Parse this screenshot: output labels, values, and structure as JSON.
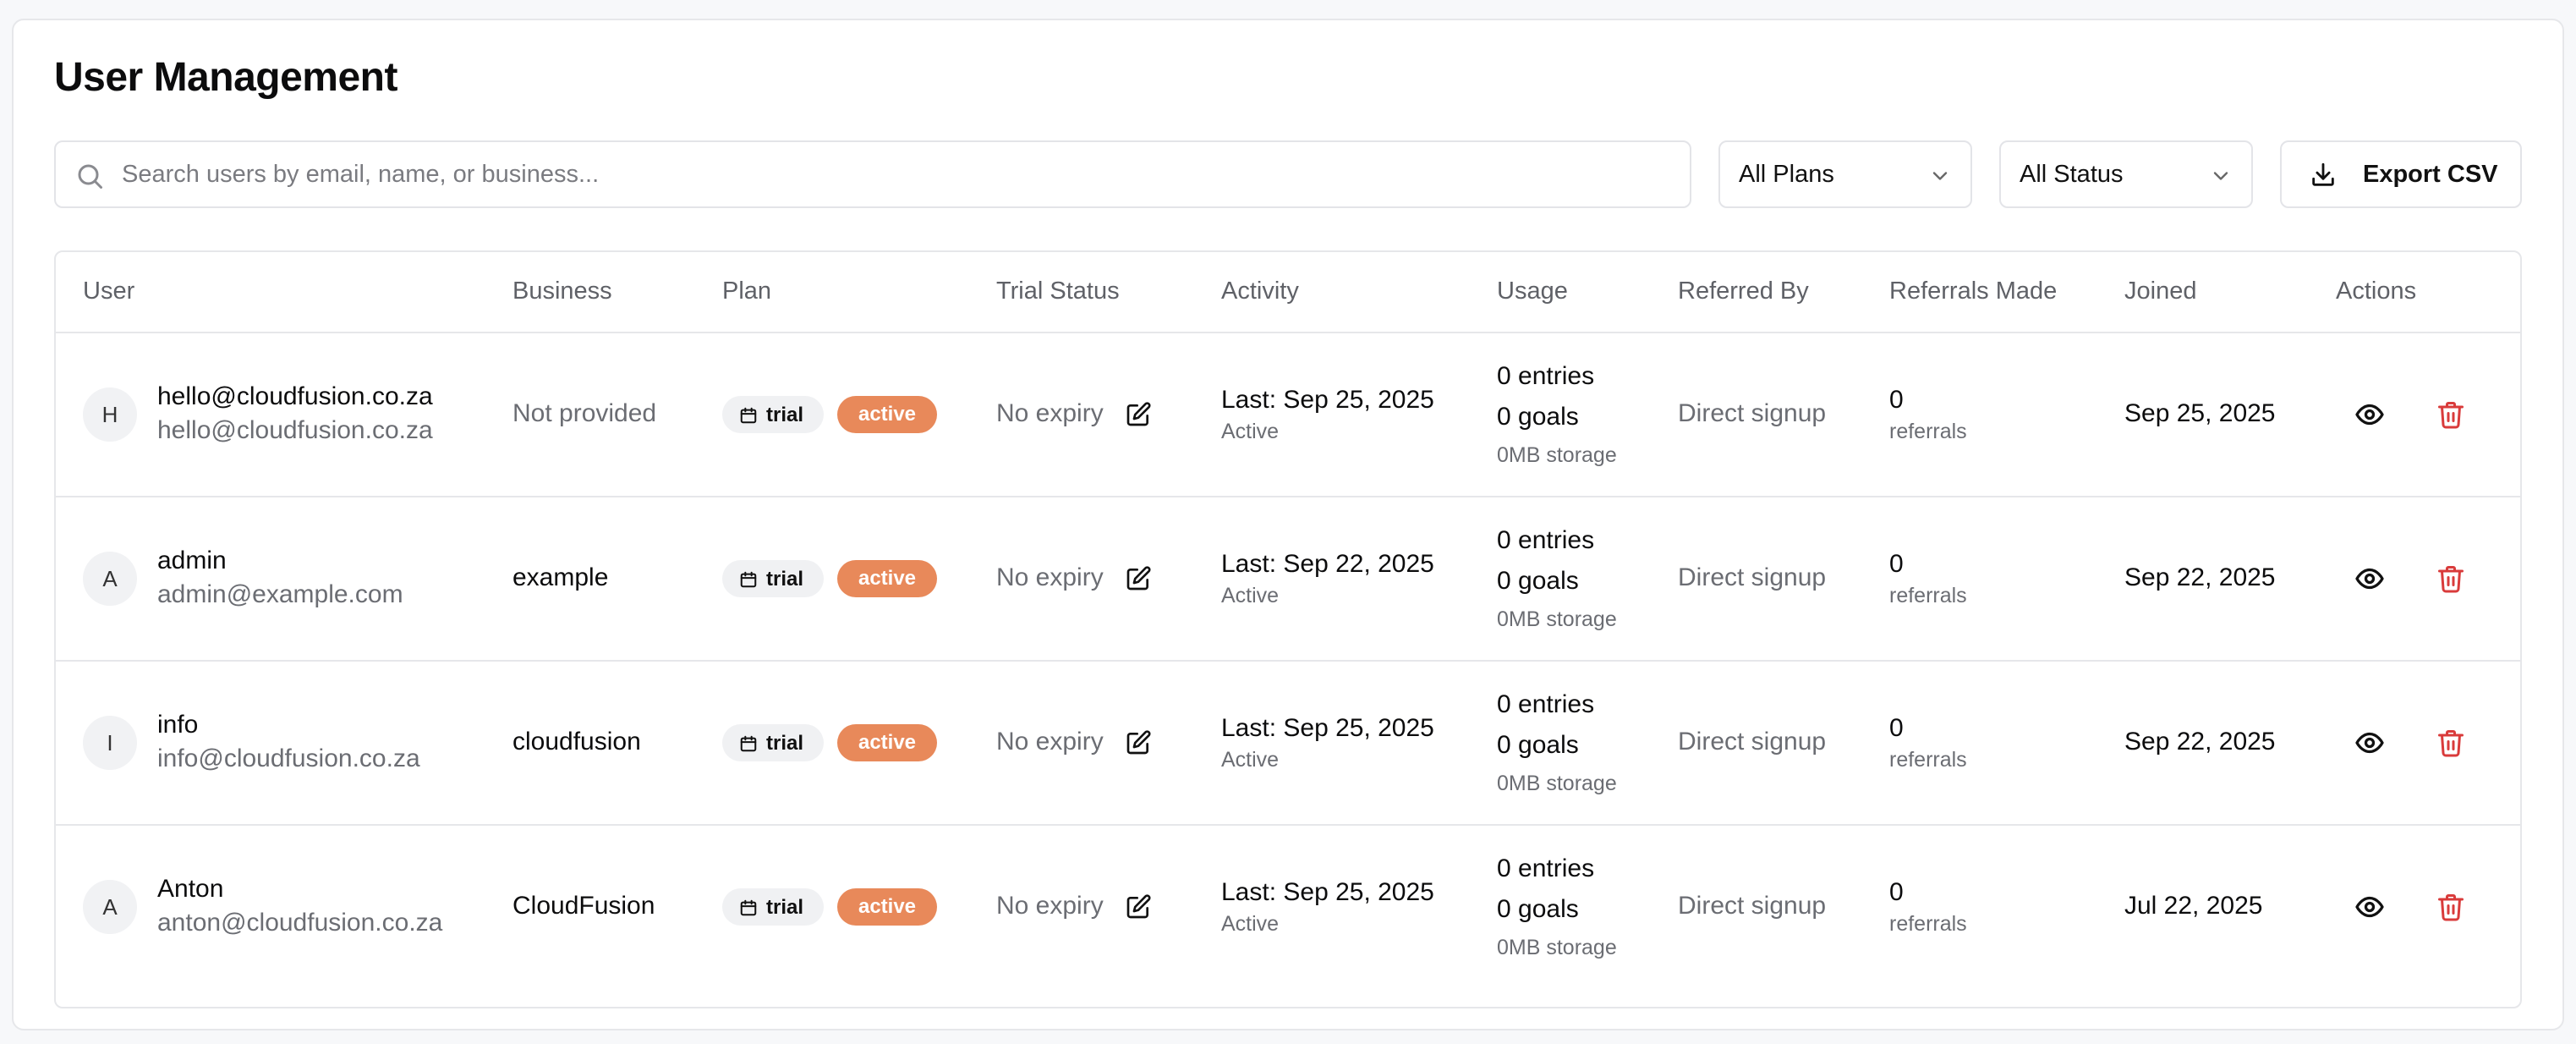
{
  "page": {
    "title": "User Management"
  },
  "search": {
    "placeholder": "Search users by email, name, or business..."
  },
  "filters": {
    "plans_selected": "All Plans",
    "status_selected": "All Status"
  },
  "export": {
    "label": "Export CSV"
  },
  "colors": {
    "active_badge": "#e8895a",
    "delete_icon": "#d93b3b"
  },
  "table": {
    "headers": [
      "User",
      "Business",
      "Plan",
      "Trial Status",
      "Activity",
      "Usage",
      "Referred By",
      "Referrals Made",
      "Joined",
      "Actions"
    ],
    "rows": [
      {
        "initial": "H",
        "name": "hello@cloudfusion.co.za",
        "email": "hello@cloudfusion.co.za",
        "business": "Not provided",
        "plan": "trial",
        "status": "active",
        "trial_status": "No expiry",
        "activity_last": "Last: Sep 25, 2025",
        "activity_state": "Active",
        "usage_entries": "0 entries",
        "usage_goals": "0 goals",
        "usage_storage": "0MB storage",
        "referred_by": "Direct signup",
        "referrals_count": "0",
        "referrals_label": "referrals",
        "joined": "Sep 25, 2025"
      },
      {
        "initial": "A",
        "name": "admin",
        "email": "admin@example.com",
        "business": "example",
        "plan": "trial",
        "status": "active",
        "trial_status": "No expiry",
        "activity_last": "Last: Sep 22, 2025",
        "activity_state": "Active",
        "usage_entries": "0 entries",
        "usage_goals": "0 goals",
        "usage_storage": "0MB storage",
        "referred_by": "Direct signup",
        "referrals_count": "0",
        "referrals_label": "referrals",
        "joined": "Sep 22, 2025"
      },
      {
        "initial": "I",
        "name": "info",
        "email": "info@cloudfusion.co.za",
        "business": "cloudfusion",
        "plan": "trial",
        "status": "active",
        "trial_status": "No expiry",
        "activity_last": "Last: Sep 25, 2025",
        "activity_state": "Active",
        "usage_entries": "0 entries",
        "usage_goals": "0 goals",
        "usage_storage": "0MB storage",
        "referred_by": "Direct signup",
        "referrals_count": "0",
        "referrals_label": "referrals",
        "joined": "Sep 22, 2025"
      },
      {
        "initial": "A",
        "name": "Anton",
        "email": "anton@cloudfusion.co.za",
        "business": "CloudFusion",
        "plan": "trial",
        "status": "active",
        "trial_status": "No expiry",
        "activity_last": "Last: Sep 25, 2025",
        "activity_state": "Active",
        "usage_entries": "0 entries",
        "usage_goals": "0 goals",
        "usage_storage": "0MB storage",
        "referred_by": "Direct signup",
        "referrals_count": "0",
        "referrals_label": "referrals",
        "joined": "Jul 22, 2025"
      }
    ]
  }
}
